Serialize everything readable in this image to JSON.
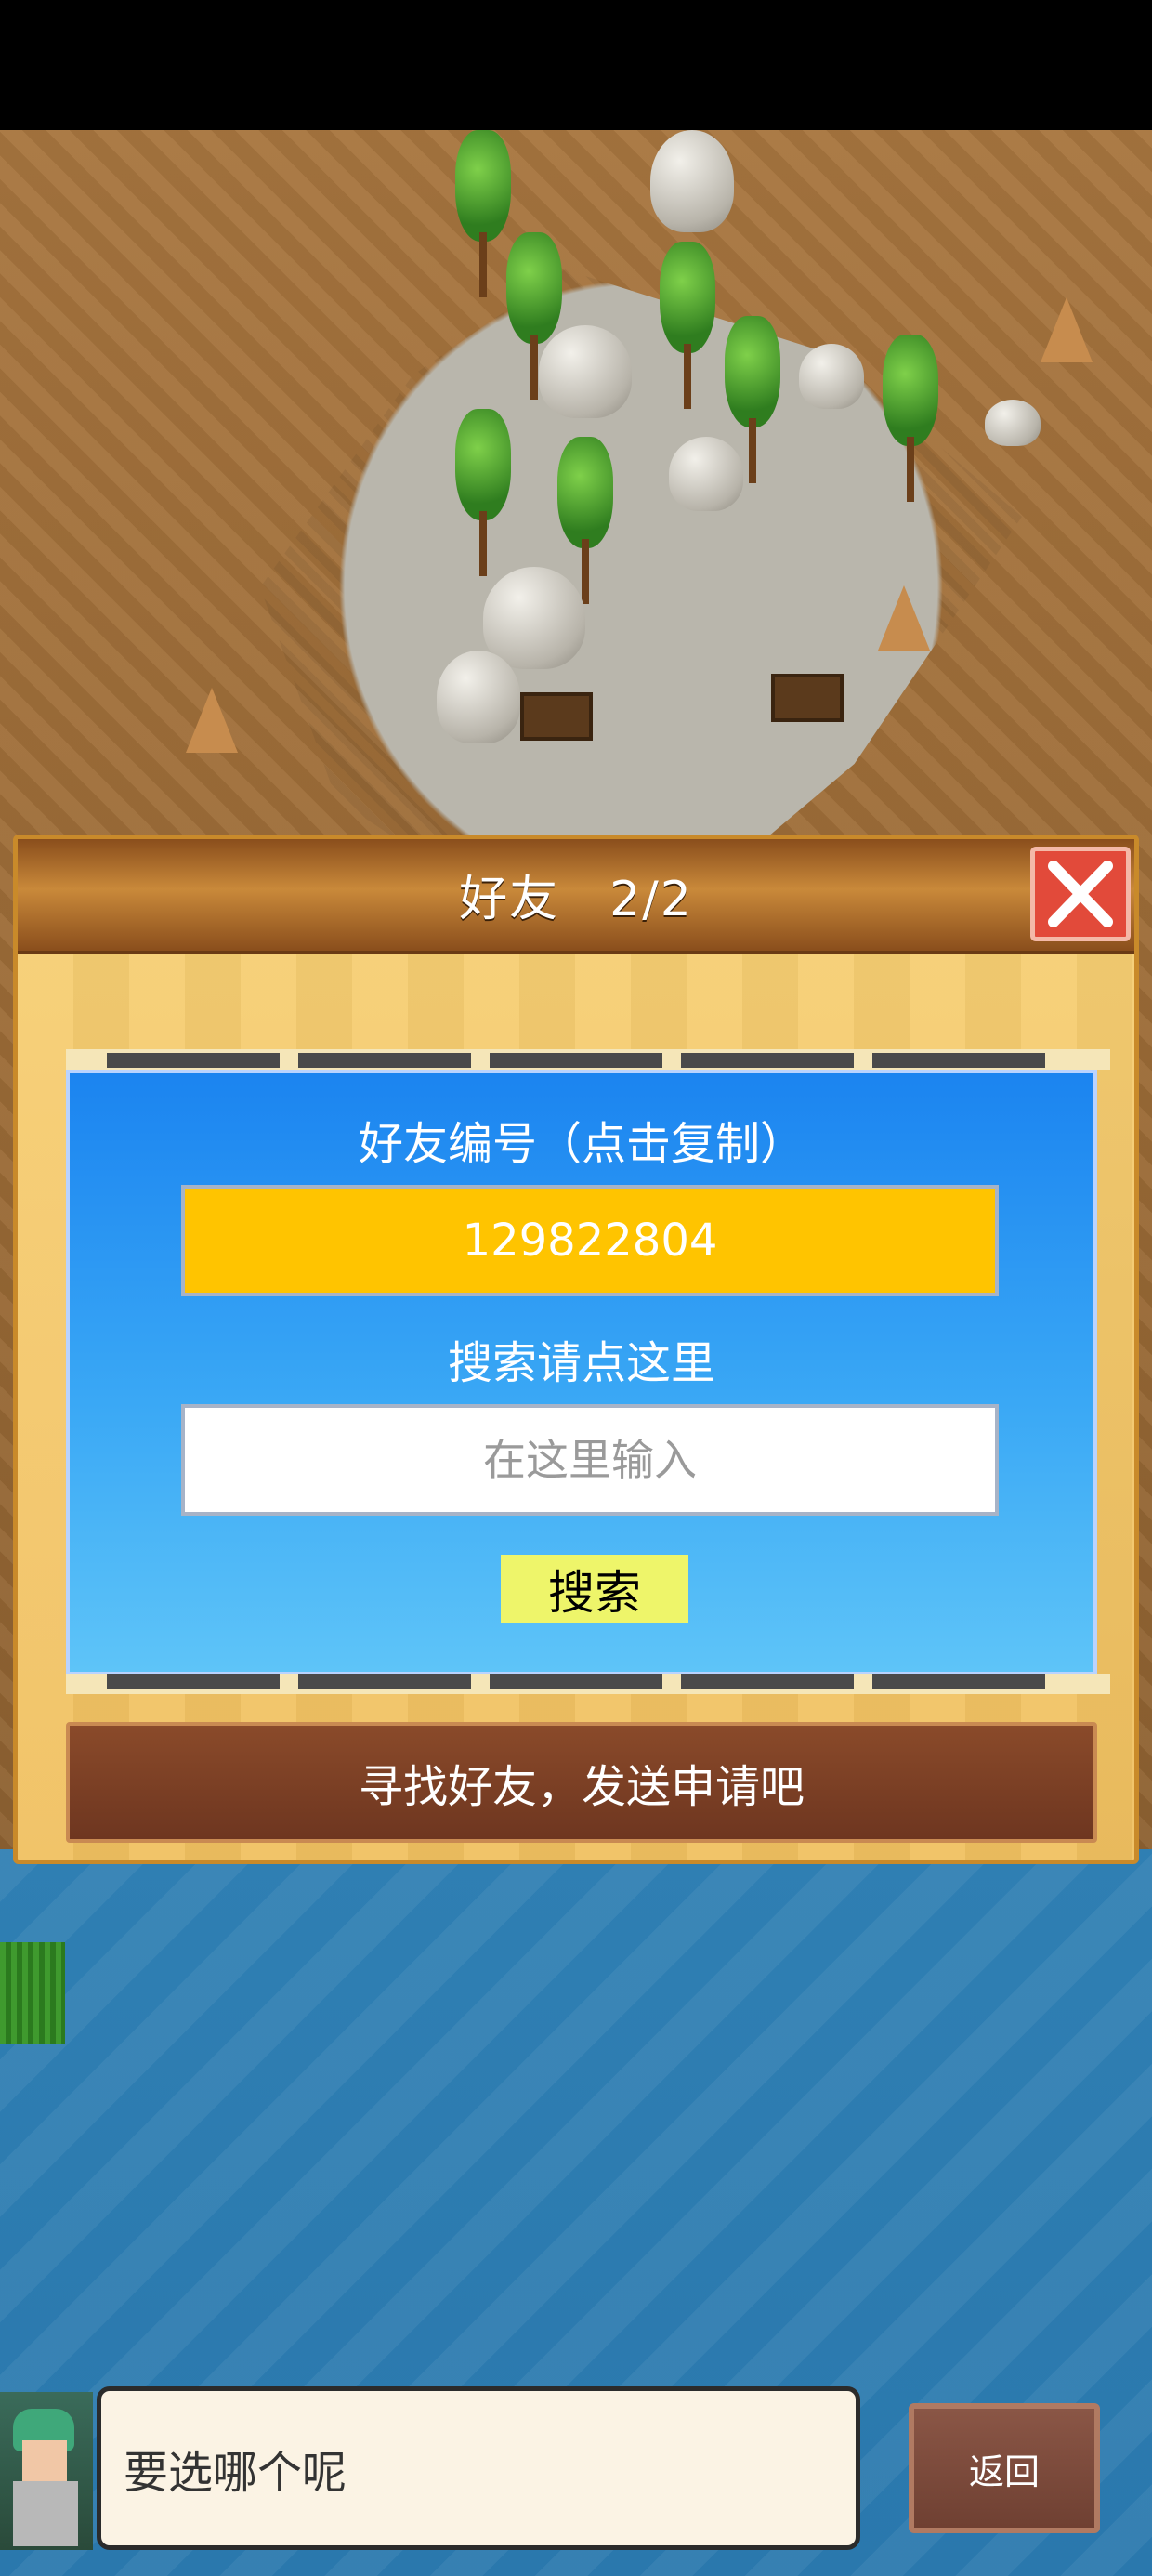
{
  "dialog": {
    "title": "好友　2/2",
    "close_icon": "close-x-icon",
    "friend_id_label": "好友编号（点击复制）",
    "friend_id_value": "129822804",
    "search_hint": "搜索请点这里",
    "search_placeholder": "在这里输入",
    "search_button": "搜索",
    "find_friends_button": "寻找好友，发送申请吧"
  },
  "bottom": {
    "speech_text": "要选哪个呢",
    "back_button": "返回"
  },
  "colors": {
    "panel_blue": "#1b84f0",
    "id_box_yellow": "#ffc400",
    "search_button": "#eef56a",
    "close_red": "#e24a3a",
    "find_button_brown": "#7a3e24"
  }
}
